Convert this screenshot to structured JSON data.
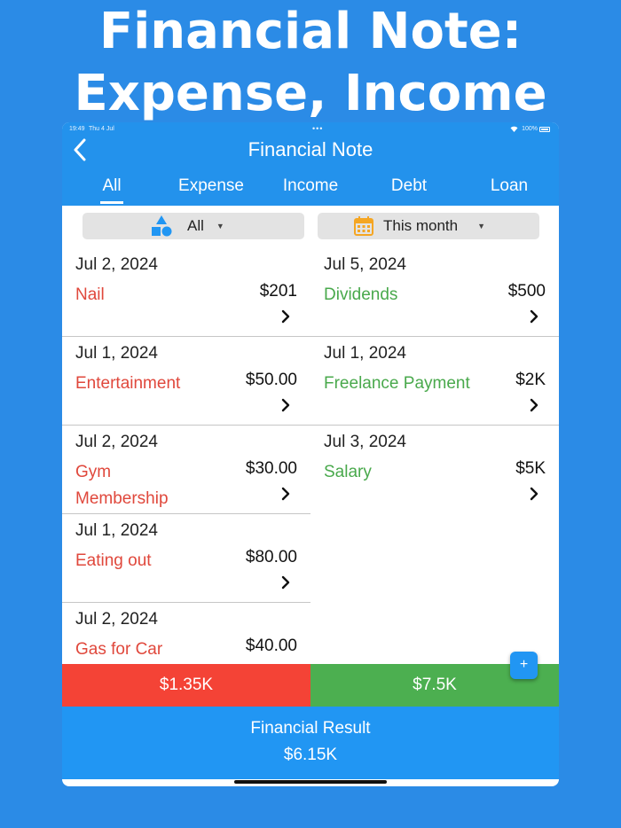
{
  "headline": {
    "line1": "Financial Note:",
    "line2": "Expense, Income"
  },
  "status_bar": {
    "time": "19:49",
    "date": "Thu 4 Jul",
    "battery": "100%"
  },
  "app": {
    "title": "Financial Note"
  },
  "tabs": [
    {
      "label": "All",
      "active": true
    },
    {
      "label": "Expense",
      "active": false
    },
    {
      "label": "Income",
      "active": false
    },
    {
      "label": "Debt",
      "active": false
    },
    {
      "label": "Loan",
      "active": false
    }
  ],
  "filters": {
    "category": {
      "label": "All",
      "icon": "shapes-icon"
    },
    "period": {
      "label": "This month",
      "icon": "calendar-icon"
    }
  },
  "expenses": [
    {
      "date": "Jul 2, 2024",
      "category": "Nail",
      "amount": "$201"
    },
    {
      "date": "Jul 1, 2024",
      "category": "Entertainment",
      "amount": "$50.00"
    },
    {
      "date": "Jul 2, 2024",
      "category": "Gym Membership",
      "amount": "$30.00"
    },
    {
      "date": "Jul 1, 2024",
      "category": "Eating out",
      "amount": "$80.00"
    },
    {
      "date": "Jul 2, 2024",
      "category": "Gas for Car",
      "amount": "$40.00"
    }
  ],
  "incomes": [
    {
      "date": "Jul 5, 2024",
      "category": "Dividends",
      "amount": "$500"
    },
    {
      "date": "Jul 1, 2024",
      "category": "Freelance Payment",
      "amount": "$2K"
    },
    {
      "date": "Jul 3, 2024",
      "category": "Salary",
      "amount": "$5K"
    }
  ],
  "totals": {
    "expense": "$1.35K",
    "income": "$7.5K"
  },
  "add_button": {
    "label": "+"
  },
  "result": {
    "label": "Financial Result",
    "value": "$6.15K"
  },
  "colors": {
    "background": "#2b8be6",
    "appbar": "#2392ec",
    "expense": "#e0483c",
    "income": "#49a94c",
    "expense_total_bg": "#f44336",
    "income_total_bg": "#4caf50",
    "result_bg": "#2196f3"
  }
}
